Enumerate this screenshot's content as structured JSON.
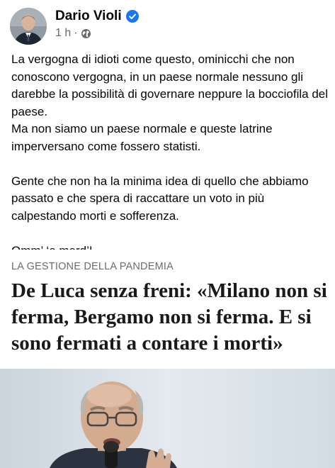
{
  "post": {
    "author": "Dario Violi",
    "time": "1 h",
    "separator": "·",
    "paragraphs": [
      [
        "La vergogna di idioti come questo, ominicchi che non conoscono vergogna, in un paese normale nessuno gli darebbe la possibilità di governare neppure la bocciofila del paese.",
        "Ma non siamo un paese normale e queste latrine imperversano come fossero statisti."
      ],
      [
        "Gente che non ha la minima idea di quello che abbiamo passato e che spera di raccattare un voto in più calpestando morti e sofferenza."
      ],
      [
        "Omm’ ‘e merd’!"
      ]
    ]
  },
  "link_preview": {
    "kicker": "LA GESTIONE DELLA PANDEMIA",
    "headline": "De Luca senza freni: «Milano non si ferma, Bergamo non si ferma. E si sono fermati a contare i morti»"
  },
  "colors": {
    "verified_blue": "#1877f2",
    "meta_gray": "#65676b"
  },
  "icons": {
    "verified": "verified-badge-icon",
    "audience": "globe-icon"
  }
}
